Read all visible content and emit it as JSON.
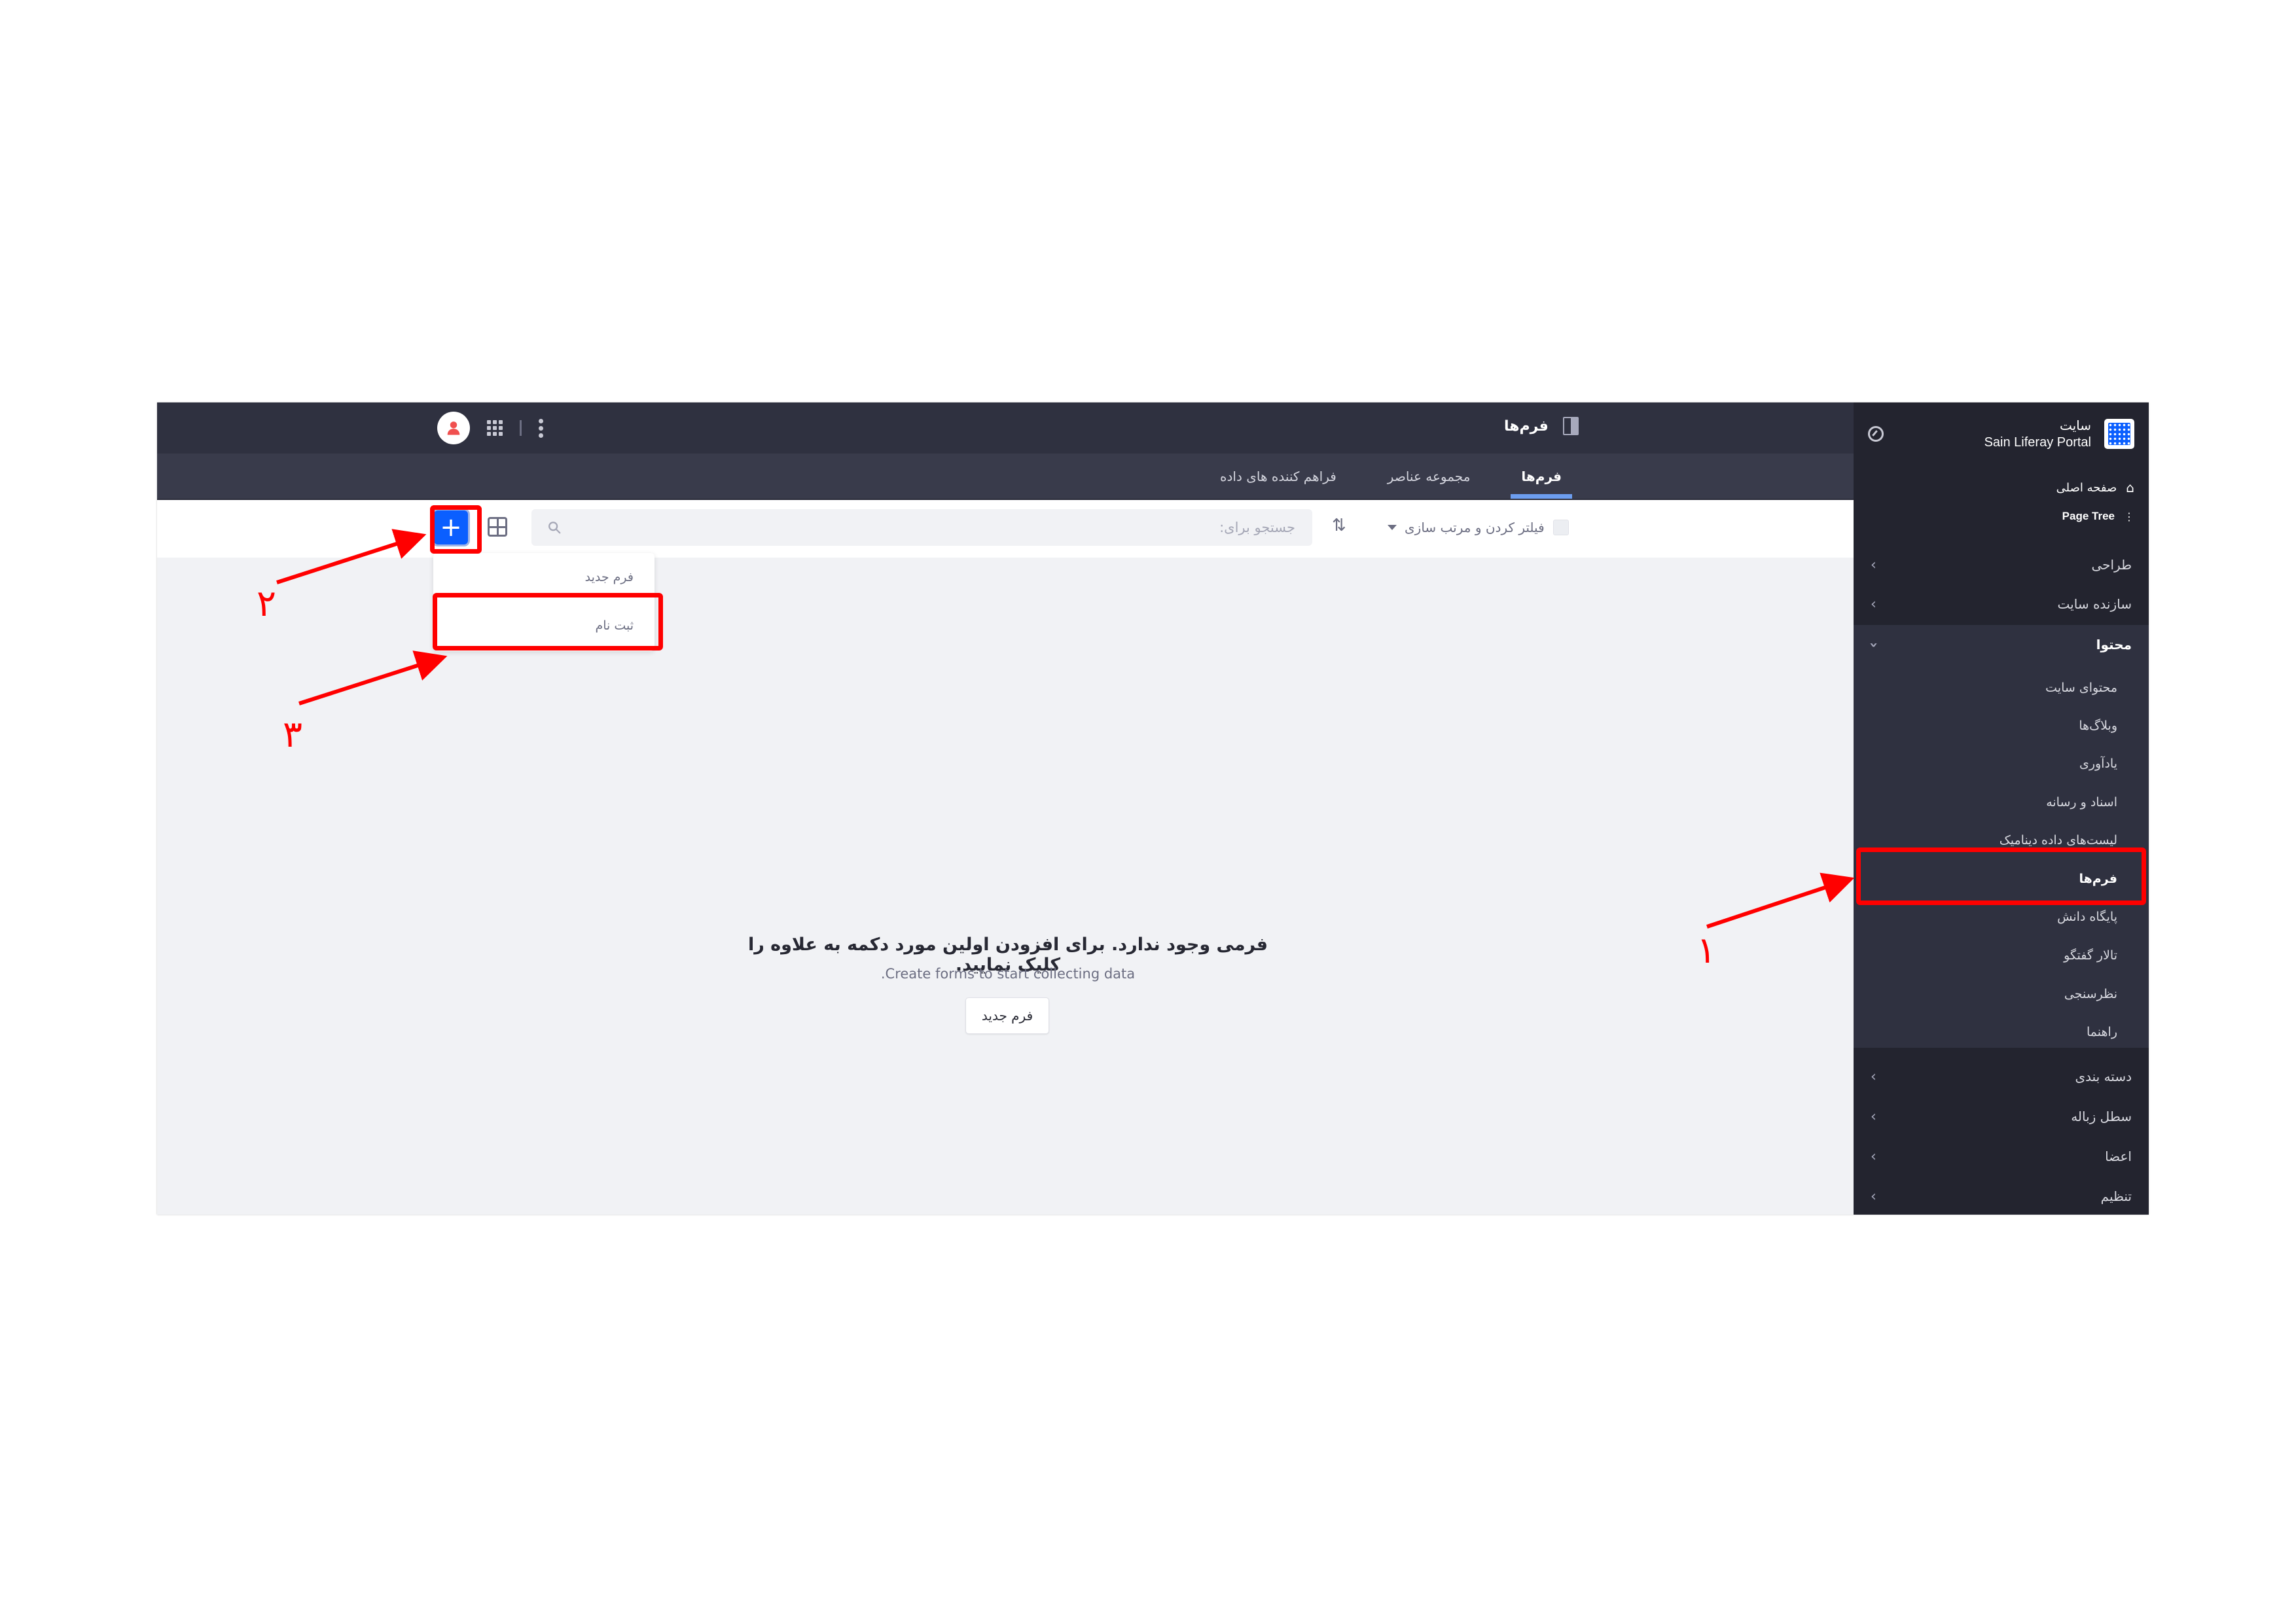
{
  "header": {
    "title": "فرم‌ها",
    "panel_icon": "sidebar-toggle-icon",
    "user_icon": "user-avatar-icon",
    "apps_icon": "apps-grid-icon",
    "menu_icon": "kebab-menu-icon"
  },
  "tabs": [
    {
      "label": "فرم‌ها",
      "active": true
    },
    {
      "label": "مجموعه عناصر",
      "active": false
    },
    {
      "label": "فراهم کننده های داده",
      "active": false
    }
  ],
  "toolbar": {
    "filter_label": "فیلتر کردن و مرتب سازی",
    "search_placeholder": "جستجو برای:",
    "search_value": "",
    "add_label": "+",
    "sort_icon": "sort-icon",
    "view_icon": "card-view-icon"
  },
  "add_menu": {
    "items": [
      {
        "label": "فرم جدید"
      },
      {
        "label": "ثبت نام"
      }
    ]
  },
  "empty_state": {
    "title": "فرمی وجود ندارد. برای افزودن اولین مورد دکمه به علاوه را کلیک نمایید.",
    "subtitle": ".Create forms to start collecting data",
    "button_label": "فرم جدید"
  },
  "sidebar": {
    "site_label": "سایت",
    "site_name": "Sain Liferay Portal",
    "links": [
      {
        "label": "صفحه اصلی",
        "icon": "home-icon"
      },
      {
        "label": "Page Tree",
        "icon": "page-tree-icon"
      }
    ],
    "sections_top": [
      {
        "label": "طراحی"
      },
      {
        "label": "سازنده سایت"
      }
    ],
    "open_section": {
      "label": "محتوا",
      "items": [
        {
          "label": "محتوای سایت"
        },
        {
          "label": "وبلاگ‌ها"
        },
        {
          "label": "یادآوری"
        },
        {
          "label": "اسناد و رسانه"
        },
        {
          "label": "لیست‌های داده دینامیک"
        },
        {
          "label": "فرم‌ها",
          "active": true
        },
        {
          "label": "پایگاه دانش"
        },
        {
          "label": "تالار گفتگو"
        },
        {
          "label": "نظرسنجی"
        },
        {
          "label": "راهنما"
        }
      ]
    },
    "sections_bottom": [
      {
        "label": "دسته بندی"
      },
      {
        "label": "سطل زباله"
      },
      {
        "label": "اعضا"
      },
      {
        "label": "تنظیم"
      }
    ]
  },
  "annotations": [
    {
      "number": "۱",
      "target": "sidebar-item-forms"
    },
    {
      "number": "۲",
      "target": "add-button"
    },
    {
      "number": "۳",
      "target": "menu-item-registration"
    }
  ],
  "colors": {
    "accent": "#0b5fff",
    "annotation": "#ff0000",
    "sidebar_bg": "#23242f",
    "header_bg": "#2f3140",
    "tab_indicator": "#6d9ef0"
  }
}
